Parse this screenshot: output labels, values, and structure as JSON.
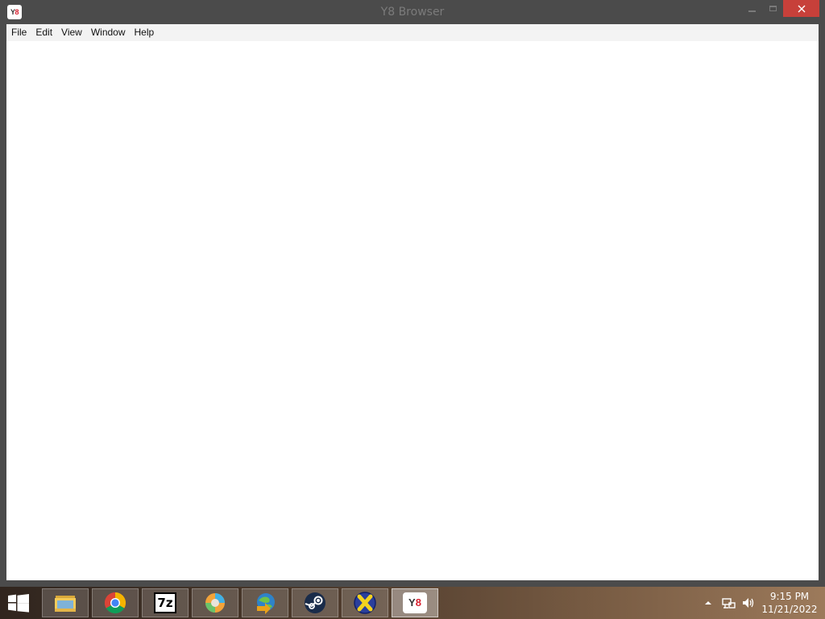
{
  "window": {
    "title": "Y8 Browser",
    "app_icon": "Y8"
  },
  "menubar": {
    "items": [
      "File",
      "Edit",
      "View",
      "Window",
      "Help"
    ]
  },
  "taskbar": {
    "apps": [
      {
        "name": "File Explorer",
        "icon": "folder-icon"
      },
      {
        "name": "Google Chrome",
        "icon": "chrome-icon"
      },
      {
        "name": "7-Zip",
        "icon": "7z-icon",
        "label": "7z"
      },
      {
        "name": "Edge Dev",
        "icon": "edge-icon"
      },
      {
        "name": "Internet Download Manager",
        "icon": "idm-icon"
      },
      {
        "name": "Steam",
        "icon": "steam-icon"
      },
      {
        "name": "Xenia",
        "icon": "x-icon"
      },
      {
        "name": "Y8 Browser",
        "icon": "y8-icon",
        "label": "Y8",
        "active": true
      }
    ],
    "clock": {
      "time": "9:15 PM",
      "date": "11/21/2022"
    }
  },
  "colors": {
    "close_button": "#c7403a",
    "window_frame": "#4b4b4b",
    "menubar": "#f3f3f3"
  }
}
